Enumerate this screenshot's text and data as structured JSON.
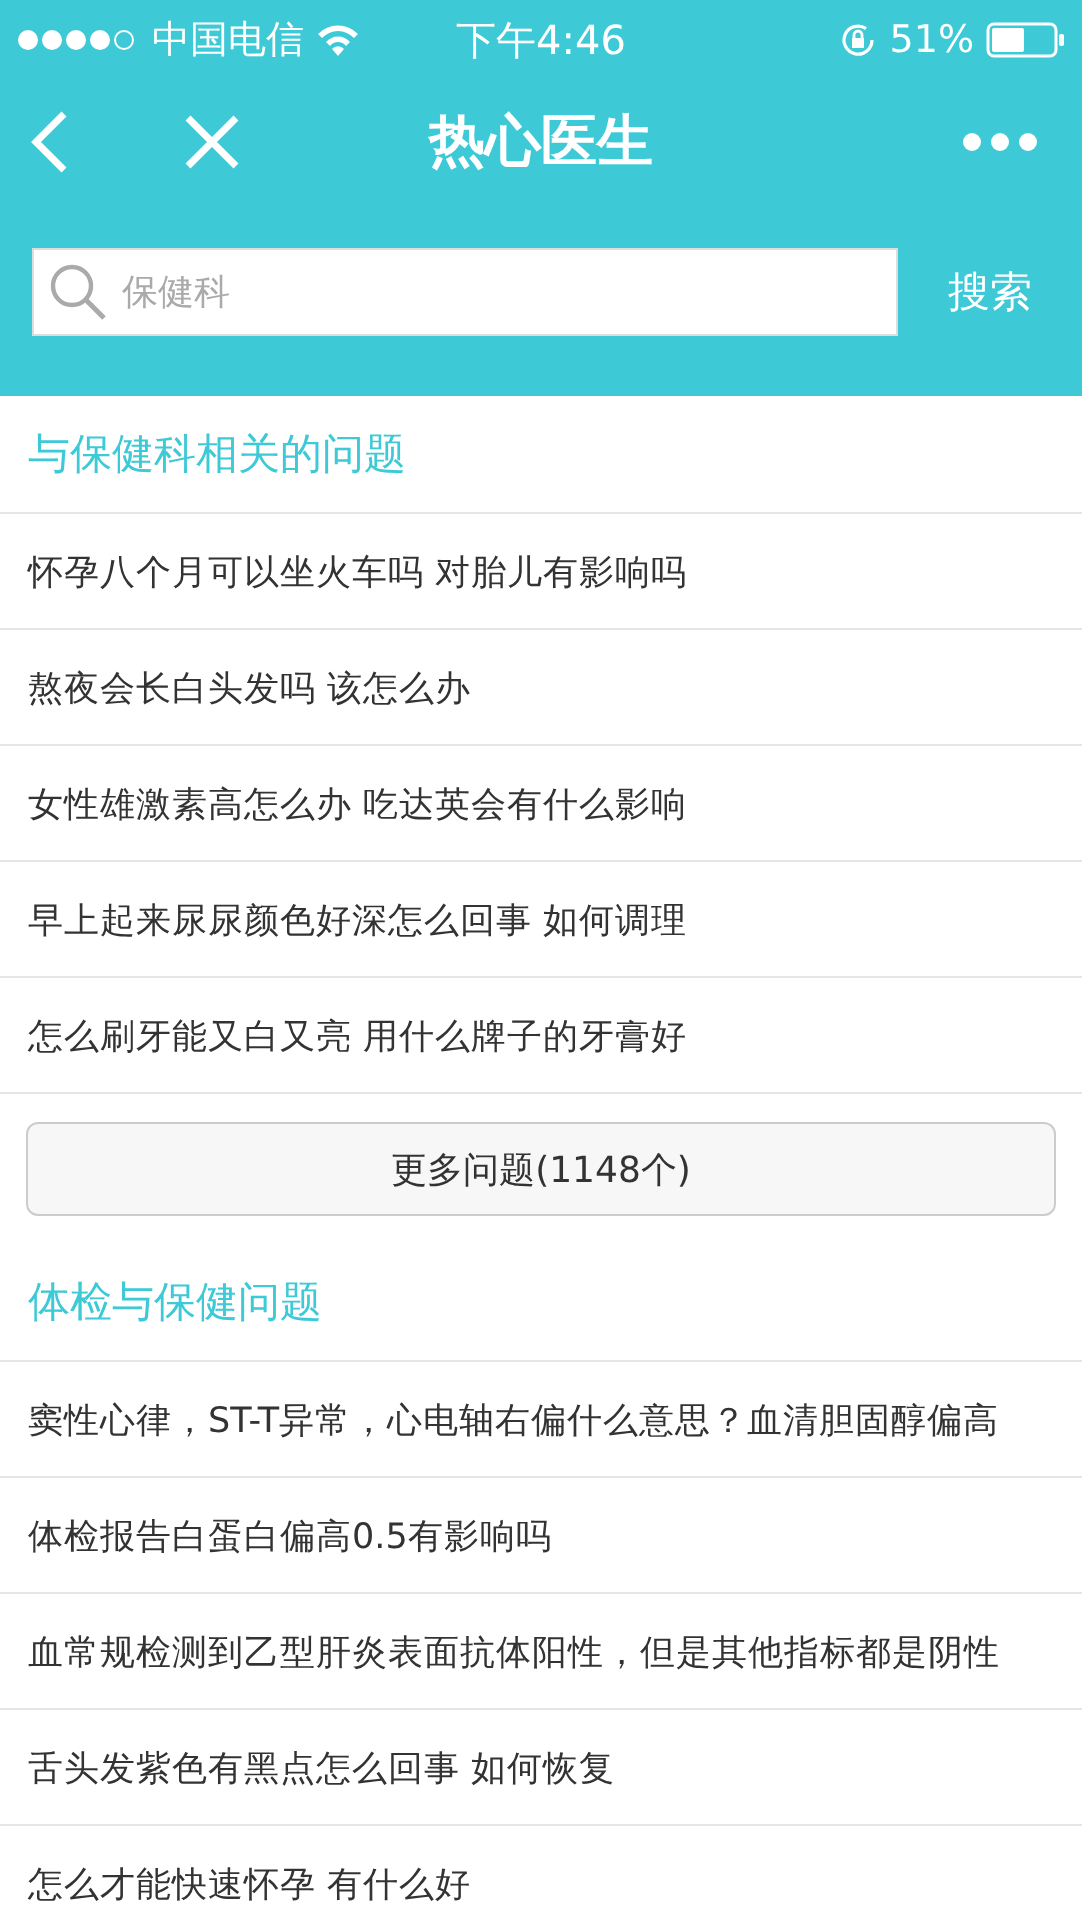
{
  "status_bar": {
    "carrier": "中国电信",
    "time": "下午4:46",
    "battery": "51%"
  },
  "nav": {
    "title": "热心医生"
  },
  "search": {
    "placeholder": "保健科",
    "button": "搜索"
  },
  "sections": [
    {
      "title": "与保健科相关的问题",
      "questions": [
        "怀孕八个月可以坐火车吗 对胎儿有影响吗",
        "熬夜会长白头发吗 该怎么办",
        "女性雄激素高怎么办 吃达英会有什么影响",
        "早上起来尿尿颜色好深怎么回事 如何调理",
        "怎么刷牙能又白又亮 用什么牌子的牙膏好"
      ],
      "more": "更多问题(1148个)"
    },
    {
      "title": "体检与保健问题",
      "questions": [
        "窦性心律，ST-T异常，心电轴右偏什么意思？血清胆固醇偏高",
        "体检报告白蛋白偏高0.5有影响吗",
        "血常规检测到乙型肝炎表面抗体阳性，但是其他指标都是阴性",
        "舌头发紫色有黑点怎么回事 如何恢复",
        "怎么才能快速怀孕 有什么好"
      ]
    }
  ]
}
